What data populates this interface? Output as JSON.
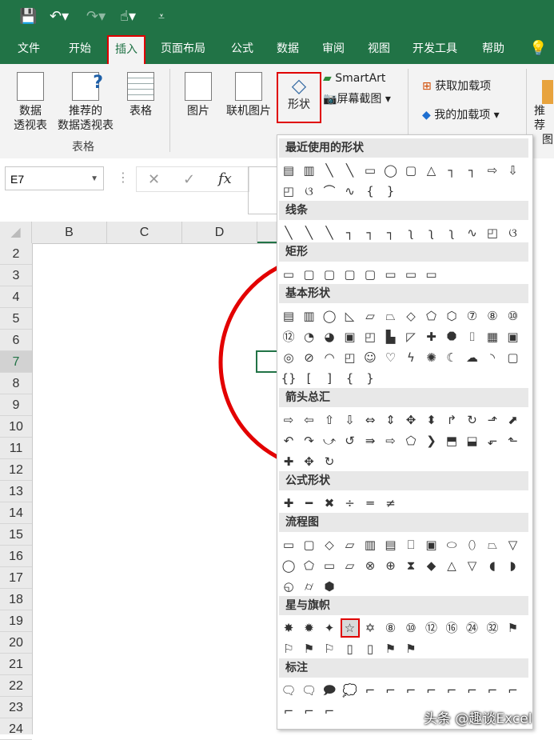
{
  "tabs": [
    "文件",
    "开始",
    "插入",
    "页面布局",
    "公式",
    "数据",
    "审阅",
    "视图",
    "开发工具",
    "帮助"
  ],
  "ribbon": {
    "pivot": "数据\n透视表",
    "pivot_l1": "数据",
    "pivot_l2": "透视表",
    "rec_pivot_l1": "推荐的",
    "rec_pivot_l2": "数据透视表",
    "table": "表格",
    "group_tables": "表格",
    "picture": "图片",
    "online_picture": "联机图片",
    "shapes": "形状",
    "smartart": "SmartArt",
    "screenshot": "屏幕截图",
    "get_addins": "获取加载项",
    "my_addins": "我的加载项",
    "rec_chart_l1": "推荐",
    "rec_chart_l2": "图"
  },
  "formula_bar": {
    "name_box": "E7",
    "fx": "fx"
  },
  "columns": [
    "B",
    "C",
    "D"
  ],
  "rows": [
    "2",
    "3",
    "4",
    "5",
    "6",
    "7",
    "8",
    "9",
    "10",
    "11",
    "12",
    "13",
    "14",
    "15",
    "16",
    "17",
    "18",
    "19",
    "20",
    "21",
    "22",
    "23",
    "24"
  ],
  "selected_row": "7",
  "shapes_panel": {
    "sections": [
      "最近使用的形状",
      "线条",
      "矩形",
      "基本形状",
      "箭头总汇",
      "公式形状",
      "流程图",
      "星与旗帜",
      "标注"
    ],
    "recent": [
      "▤",
      "▥",
      "╲",
      "╲",
      "▭",
      "◯",
      "▢",
      "△",
      "┐",
      "┐",
      "⇨",
      "⇩",
      "◰",
      "ଓ",
      "⌒",
      "∿",
      "{",
      "}"
    ],
    "lines": [
      "╲",
      "╲",
      "╲",
      "┐",
      "┐",
      "┐",
      "ʅ",
      "ʅ",
      "ʅ",
      "∿",
      "◰",
      "ଓ"
    ],
    "rects": [
      "▭",
      "▢",
      "▢",
      "▢",
      "▢",
      "▭",
      "▭",
      "▭"
    ],
    "basic": [
      "▤",
      "▥",
      "◯",
      "◺",
      "▱",
      "⏢",
      "◇",
      "⬠",
      "⬡",
      "⑦",
      "⑧",
      "⑩",
      "⑫",
      "◔",
      "◕",
      "▣",
      "◰",
      "▙",
      "◸",
      "✚",
      "⯃",
      "⌷",
      "▦",
      "▣",
      "◎",
      "⊘",
      "◠",
      "◰",
      "☺",
      "♡",
      "ϟ",
      "✺",
      "☾",
      "☁",
      "◝",
      "▢",
      "{}",
      "[",
      "]",
      "{",
      "}"
    ],
    "arrows": [
      "⇨",
      "⇦",
      "⇧",
      "⇩",
      "⇔",
      "⇕",
      "✥",
      "⬍",
      "↱",
      "↻",
      "⬏",
      "⬈",
      "↶",
      "↷",
      "⤻",
      "↺",
      "⇛",
      "⇨",
      "⬠",
      "❯",
      "⬒",
      "⬓",
      "⬐",
      "⬑",
      "✚",
      "✥",
      "↻"
    ],
    "equation": [
      "✚",
      "━",
      "✖",
      "÷",
      "═",
      "≠"
    ],
    "flow": [
      "▭",
      "▢",
      "◇",
      "▱",
      "▥",
      "▤",
      "⎕",
      "▣",
      "⬭",
      "⬯",
      "⏢",
      "▽",
      "◯",
      "⬠",
      "▭",
      "⏥",
      "⊗",
      "⊕",
      "⧗",
      "◆",
      "△",
      "▽",
      "◖",
      "◗",
      "◵",
      "⌭",
      "⬢"
    ],
    "stars": [
      "✸",
      "✹",
      "✦",
      "☆",
      "✡",
      "⑧",
      "⑩",
      "⑫",
      "⑯",
      "㉔",
      "㉜",
      "⚑",
      "⚐",
      "⚑",
      "⚐",
      "▯",
      "▯",
      "⚑",
      "⚑"
    ],
    "callouts": [
      "🗨",
      "🗨",
      "🗩",
      "💭",
      "⌐",
      "⌐",
      "⌐",
      "⌐",
      "⌐",
      "⌐",
      "⌐",
      "⌐",
      "⌐",
      "⌐",
      "⌐"
    ]
  },
  "watermark": "头条 @趣谈Excel",
  "colors": {
    "accent": "#217346",
    "highlight": "#e00000",
    "circle": "#e30000"
  }
}
